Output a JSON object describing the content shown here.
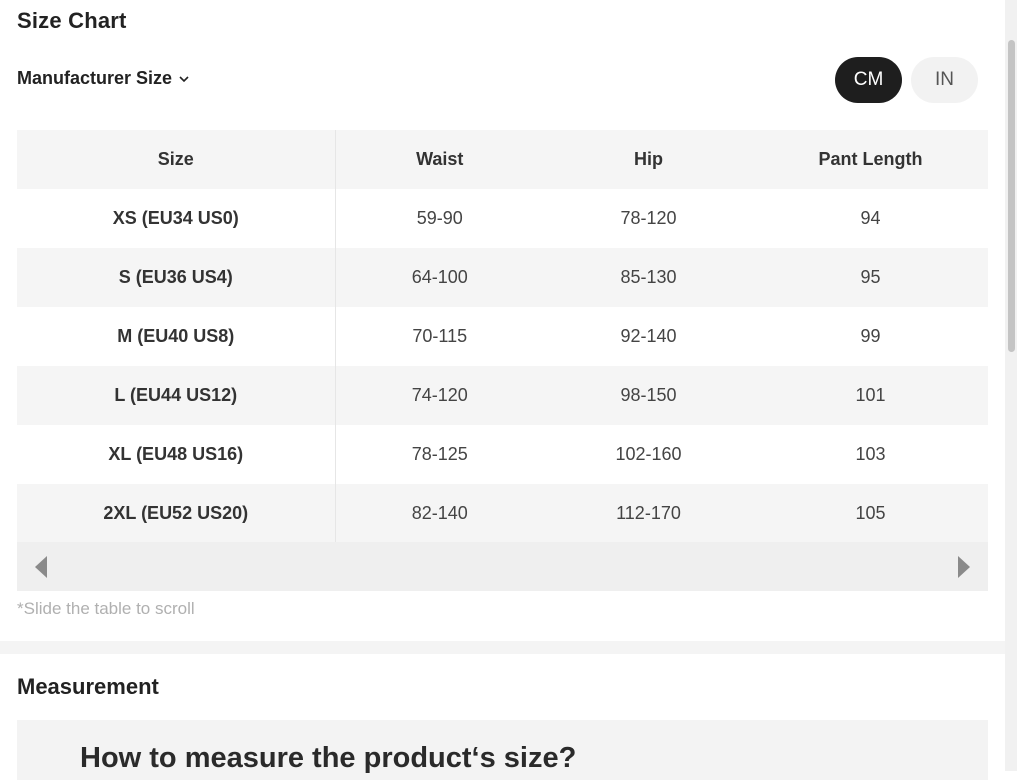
{
  "header": {
    "title": "Size Chart",
    "manufacturer_label": "Manufacturer Size",
    "dropdown_icon": "chevron-down-icon"
  },
  "units": {
    "options": [
      "CM",
      "IN"
    ],
    "selected": "CM"
  },
  "table": {
    "columns": [
      "Size",
      "Waist",
      "Hip",
      "Pant Length"
    ],
    "rows": [
      [
        "XS (EU34 US0)",
        "59-90",
        "78-120",
        "94"
      ],
      [
        "S (EU36 US4)",
        "64-100",
        "85-130",
        "95"
      ],
      [
        "M (EU40 US8)",
        "70-115",
        "92-140",
        "99"
      ],
      [
        "L (EU44 US12)",
        "74-120",
        "98-150",
        "101"
      ],
      [
        "XL (EU48 US16)",
        "78-125",
        "102-160",
        "103"
      ],
      [
        "2XL (EU52 US20)",
        "82-140",
        "112-170",
        "105"
      ]
    ]
  },
  "scroll": {
    "left_icon": "triangle-left-icon",
    "right_icon": "triangle-right-icon",
    "hint": "*Slide the table to scroll"
  },
  "measurement": {
    "title": "Measurement",
    "heading": "How to measure the product‘s size?"
  }
}
